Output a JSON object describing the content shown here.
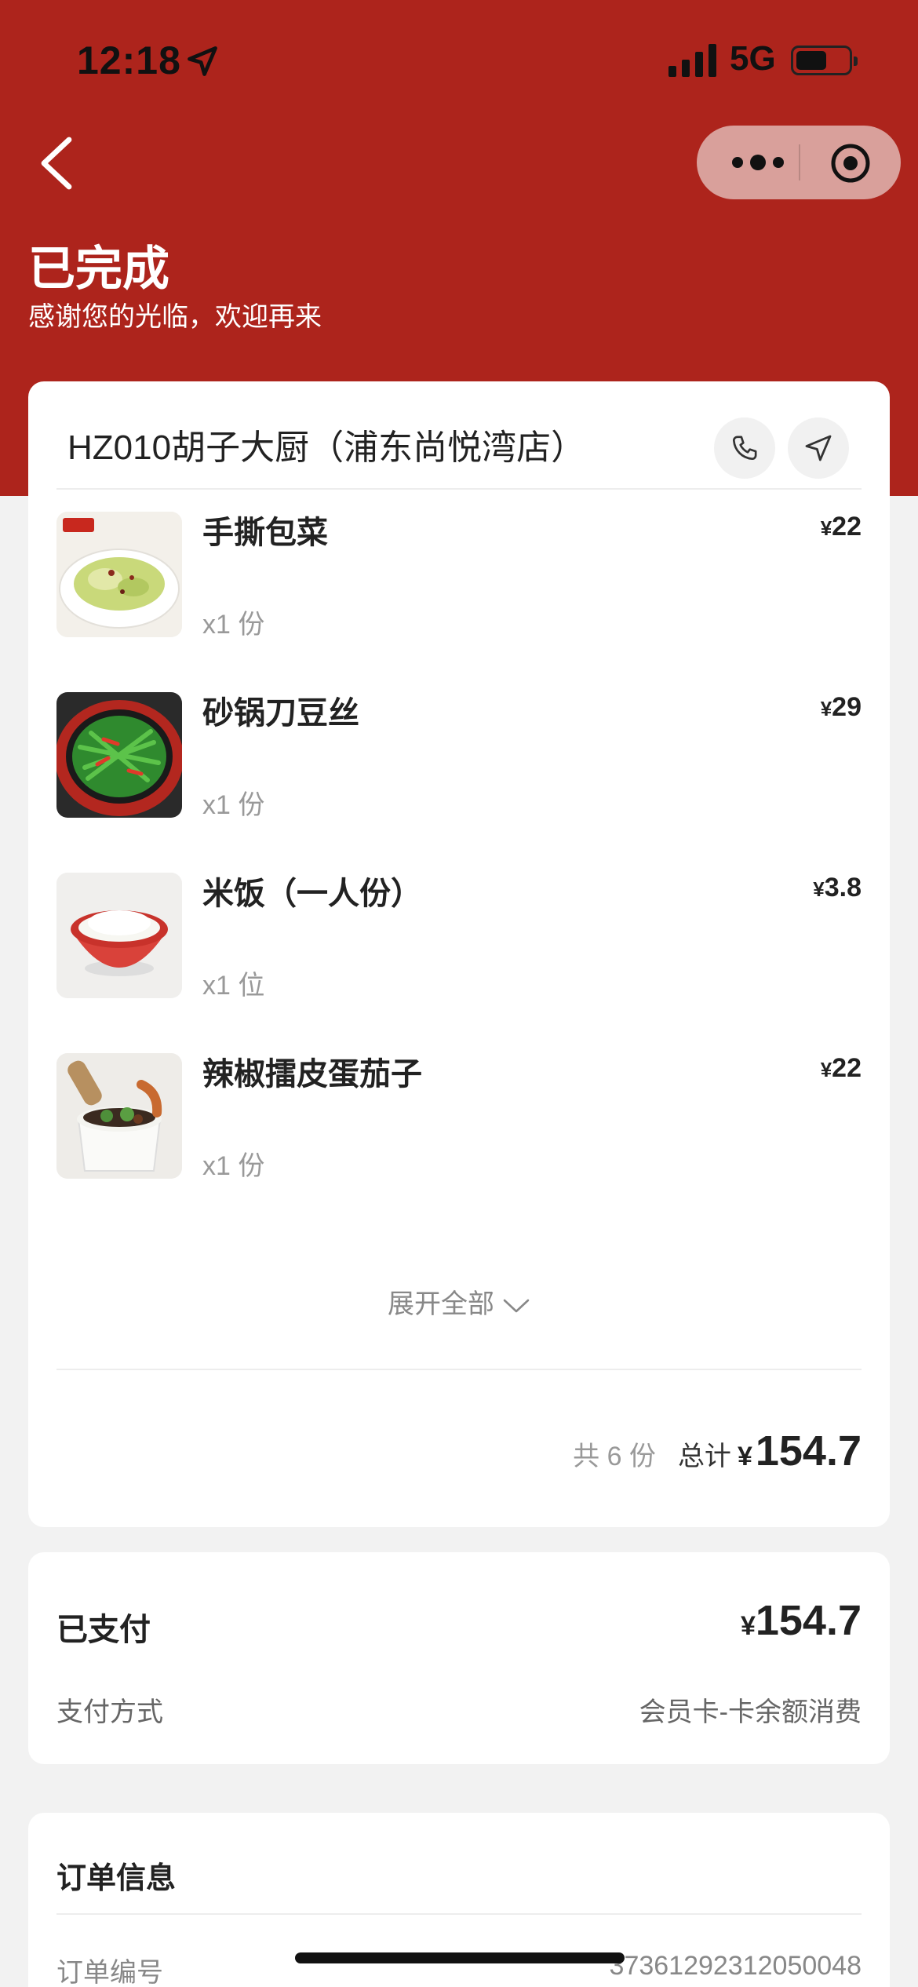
{
  "status_bar": {
    "time": "12:18",
    "network": "5G"
  },
  "header": {
    "title": "已完成",
    "subtitle": "感谢您的光临，欢迎再来"
  },
  "store": {
    "name": "HZ010胡子大厨（浦东尚悦湾店）"
  },
  "items": [
    {
      "name": "手撕包菜",
      "qty": "x1 份",
      "currency": "¥",
      "price": "22",
      "image": "cabbage-dish"
    },
    {
      "name": "砂锅刀豆丝",
      "qty": "x1 份",
      "currency": "¥",
      "price": "29",
      "image": "green-beans-claypot"
    },
    {
      "name": "米饭（一人份）",
      "qty": "x1 位",
      "currency": "¥",
      "price": "3.8",
      "image": "rice-bowl"
    },
    {
      "name": "辣椒擂皮蛋茄子",
      "qty": "x1 份",
      "currency": "¥",
      "price": "22",
      "image": "pestle-eggplant"
    }
  ],
  "expand_label": "展开全部",
  "summary": {
    "count_text": "共 6 份",
    "total_label": "总计",
    "currency": "¥",
    "total": "154.7"
  },
  "payment": {
    "paid_label": "已支付",
    "currency": "¥",
    "amount": "154.7",
    "method_label": "支付方式",
    "method_value": "会员卡-卡余额消费"
  },
  "order_info": {
    "title": "订单信息",
    "number_label": "订单编号",
    "number_value": "37361292312050048"
  },
  "colors": {
    "brand_red": "#ad241c",
    "capsule": "#d9a09b",
    "background": "#f2f2f2"
  }
}
